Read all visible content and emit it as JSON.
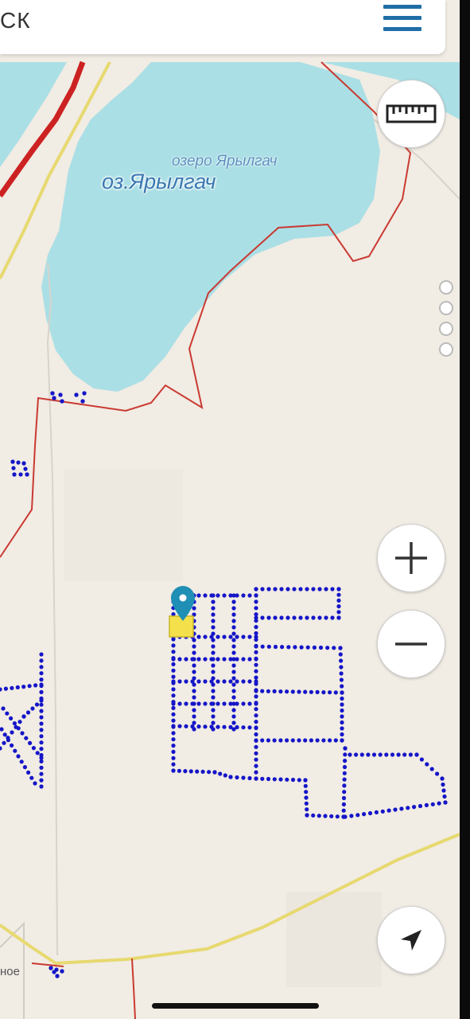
{
  "topbar": {
    "search_text": "СК",
    "menu_icon": "hamburger-menu-icon"
  },
  "map": {
    "labels": {
      "lake_small": "озеро Ярылгач",
      "lake_main": "оз.Ярылгач",
      "settlement": "ное"
    },
    "colors": {
      "land": "#f1ece4",
      "water": "#aadfe5",
      "boundary": "#c93a32",
      "highway": "#cc2222",
      "road": "#e7d970",
      "plots": "#1515c8",
      "marker": "#1f8fb5",
      "marker_square": "#f4e04a"
    }
  },
  "controls": {
    "ruler_icon": "ruler-icon",
    "zoom_in_icon": "plus-icon",
    "zoom_out_icon": "minus-icon",
    "locate_icon": "navigation-arrow-icon",
    "layers_icon": "more-dots-icon"
  }
}
